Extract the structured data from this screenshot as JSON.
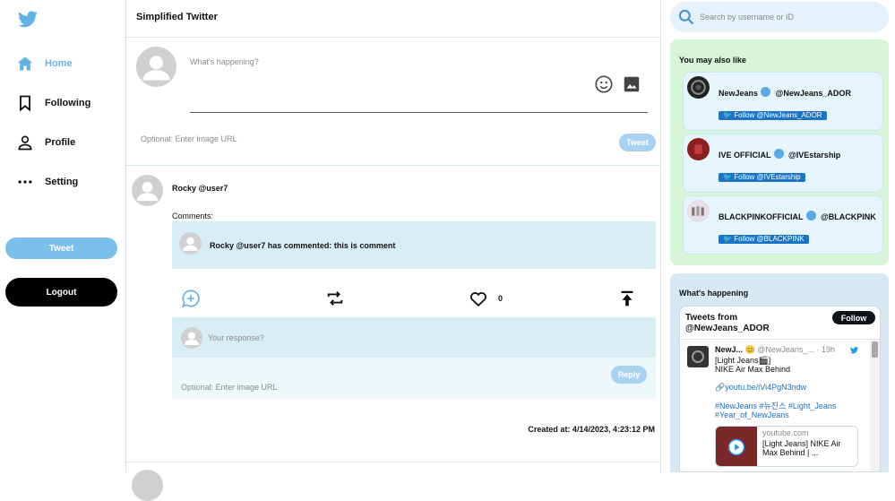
{
  "colors": {
    "accent": "#62b3e4",
    "suggest_bg": "#d7f5d7",
    "trends_bg": "#d7e8f5",
    "comment_bg": "#d7eef5"
  },
  "sidebar": {
    "items": [
      {
        "label": "Home",
        "icon": "home-icon"
      },
      {
        "label": "Following",
        "icon": "bookmark-icon"
      },
      {
        "label": "Profile",
        "icon": "person-icon"
      },
      {
        "label": "Setting",
        "icon": "more-icon"
      }
    ],
    "tweet_button": "Tweet",
    "logout_button": "Logout"
  },
  "main": {
    "title": "Simplified Twitter",
    "composer": {
      "placeholder": "What's happening?",
      "image_placeholder": "Optional: Enter image URL",
      "tweet_button": "Tweet"
    },
    "post": {
      "author": "Rocky @user7",
      "comments_label": "Comments:",
      "comment_text": "Rocky @user7 has commented: this is comment",
      "like_count": "0",
      "response_placeholder": "Your response?",
      "image_placeholder": "Optional: Enter image URL",
      "reply_button": "Reply",
      "created_at": "Created at: 4/14/2023, 4:23:12 PM"
    }
  },
  "right": {
    "search_placeholder": "Search by username or ID",
    "suggestions_title": "You may also like",
    "suggestions": [
      {
        "name": "NewJeans",
        "handle": "@NewJeans_ADOR",
        "follow": "Follow @NewJeans_ADOR"
      },
      {
        "name": "IVE OFFICIAL",
        "handle": "@IVEstarship",
        "follow": "Follow @IVEstarship"
      },
      {
        "name": "BLACKPINKOFFICIAL",
        "handle": "@BLACKPINK",
        "follow": "Follow @BLACKPINK"
      }
    ],
    "trends_title": "What's happening",
    "timeline": {
      "header": "Tweets from @NewJeans_ADOR",
      "follow_button": "Follow",
      "tweet": {
        "name": "NewJ...",
        "handle": "@NewJeans_...",
        "time": "· 19h",
        "line1": "[Light Jeans🎬]",
        "line2": "NIKE Air Max Behind",
        "link": "youtu.be/iVi4PgN3ndw",
        "hashtags1": "#NewJeans #뉴진스 #Light_Jeans",
        "hashtags2": "#Year_of_NewJeans",
        "card_domain": "youtube.com",
        "card_title1": "[Light Jeans] NIKE Air",
        "card_title2": "Max Behind | ..."
      }
    }
  }
}
